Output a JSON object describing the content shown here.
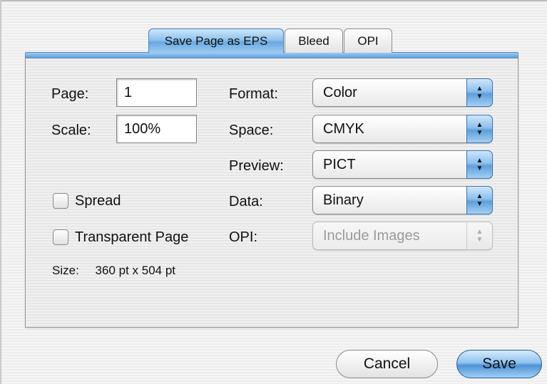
{
  "tabs": [
    {
      "label": "Save Page as EPS",
      "active": true
    },
    {
      "label": "Bleed",
      "active": false
    },
    {
      "label": "OPI",
      "active": false
    }
  ],
  "form": {
    "page_label": "Page:",
    "page_value": "1",
    "scale_label": "Scale:",
    "scale_value": "100%",
    "spread_label": "Spread",
    "spread_checked": false,
    "transparent_label": "Transparent Page",
    "transparent_checked": false,
    "size_label": "Size:",
    "size_value": "360 pt x 504 pt"
  },
  "options": {
    "format_label": "Format:",
    "format_value": "Color",
    "space_label": "Space:",
    "space_value": "CMYK",
    "preview_label": "Preview:",
    "preview_value": "PICT",
    "data_label": "Data:",
    "data_value": "Binary",
    "opi_label": "OPI:",
    "opi_value": "Include Images",
    "opi_enabled": false
  },
  "buttons": {
    "cancel": "Cancel",
    "save": "Save"
  },
  "icons": {
    "popup_arrows": "up-down-arrows-icon",
    "arrow_up_glyph": "▲",
    "arrow_down_glyph": "▼"
  },
  "colors": {
    "accent": "#6aa9e0",
    "disabled_text": "#9b9b9b"
  }
}
